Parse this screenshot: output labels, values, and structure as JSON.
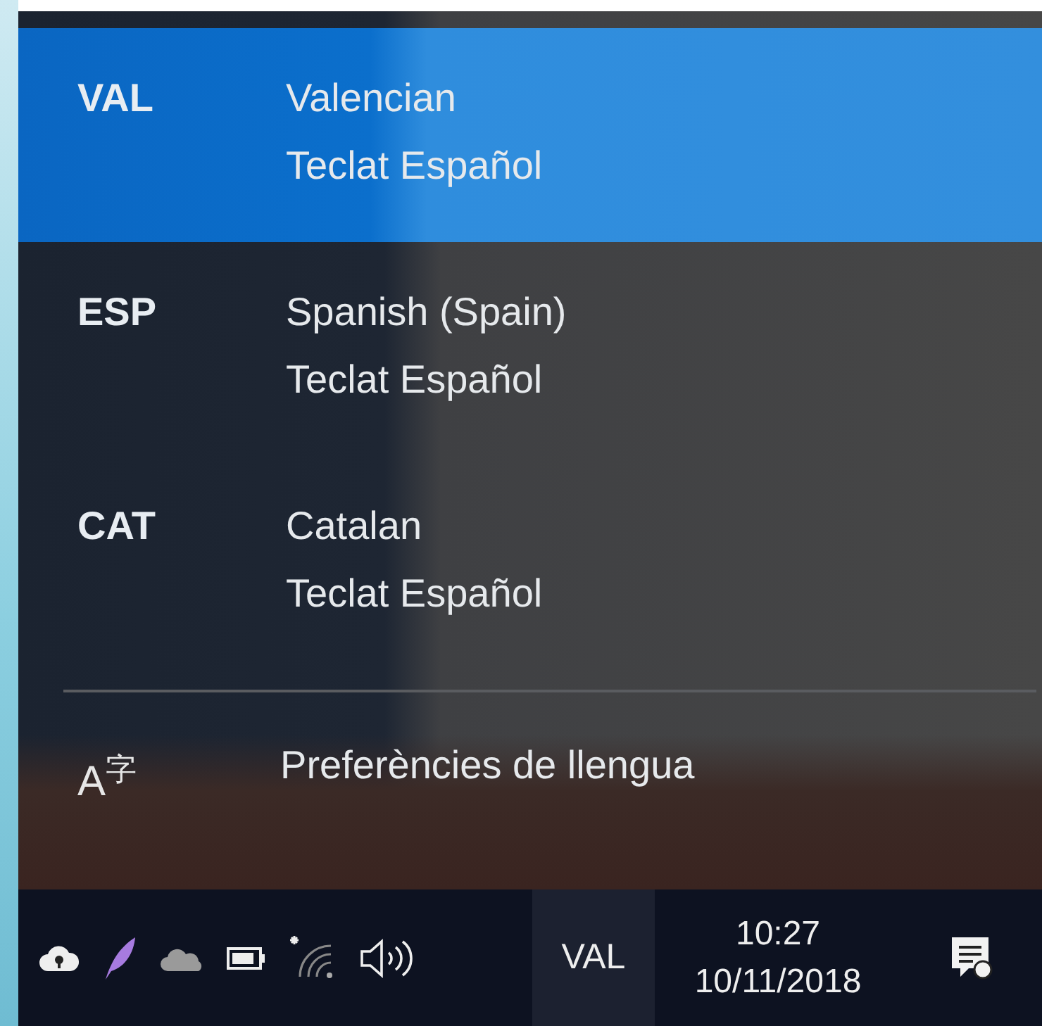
{
  "languages": [
    {
      "code": "VAL",
      "name": "Valencian",
      "keyboard": "Teclat Español",
      "selected": true
    },
    {
      "code": "ESP",
      "name": "Spanish (Spain)",
      "keyboard": "Teclat Español",
      "selected": false
    },
    {
      "code": "CAT",
      "name": "Catalan",
      "keyboard": "Teclat Español",
      "selected": false
    }
  ],
  "preferences": {
    "icon": "A$^{字}$",
    "label": "Preferències de llengua"
  },
  "taskbar": {
    "tray_icons": [
      {
        "kind": "cloud-lock"
      },
      {
        "kind": "feather"
      },
      {
        "kind": "cloud"
      },
      {
        "kind": "battery"
      },
      {
        "kind": "wifi"
      },
      {
        "kind": "speaker"
      }
    ],
    "input_indicator": "VAL",
    "time": "10:27",
    "date": "10/11/2018",
    "notifications": {
      "kind": "notes"
    }
  }
}
